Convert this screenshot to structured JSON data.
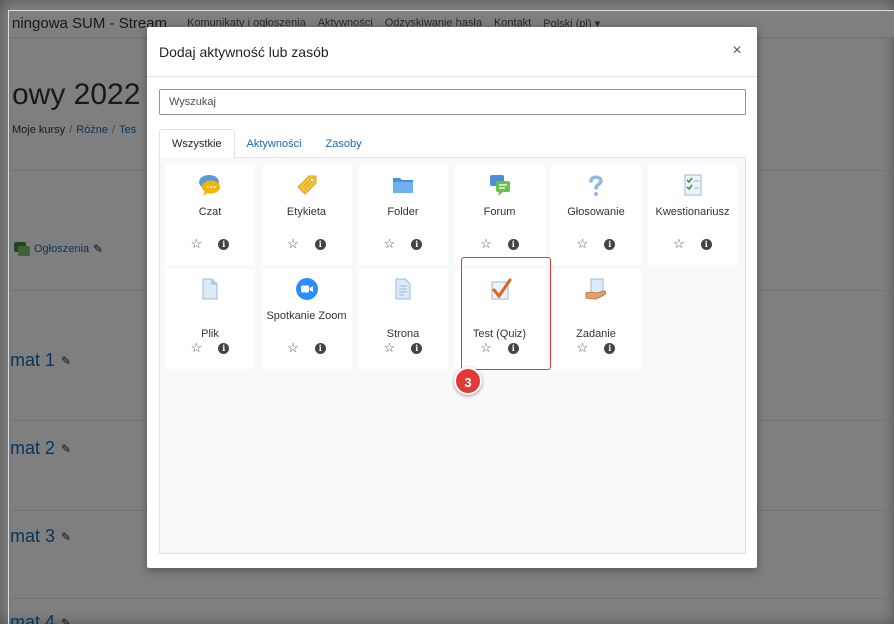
{
  "background": {
    "site_name": "ningowa SUM - Stream",
    "nav": [
      "Komunikaty i ogłoszenia",
      "Aktywności",
      "Odzyskiwanie hasła",
      "Kontakt",
      "Polski (pl) ▾"
    ],
    "course_title": "owy 2022",
    "breadcrumb": {
      "item1": "Moje kursy",
      "item2": "Różne",
      "item3": "Tes"
    },
    "announcements": "Ogłoszenia",
    "topics": [
      "mat 1",
      "mat 2",
      "mat 3",
      "mat 4"
    ]
  },
  "modal": {
    "title": "Dodaj aktywność lub zasób",
    "close": "×",
    "search_placeholder": "Wyszukaj",
    "tabs": [
      "Wszystkie",
      "Aktywności",
      "Zasoby"
    ],
    "items": [
      {
        "name": "Czat",
        "icon": "chat-icon"
      },
      {
        "name": "Etykieta",
        "icon": "label-icon"
      },
      {
        "name": "Folder",
        "icon": "folder-icon"
      },
      {
        "name": "Forum",
        "icon": "forum-icon"
      },
      {
        "name": "Głosowanie",
        "icon": "question-icon"
      },
      {
        "name": "Kwestionariusz",
        "icon": "questionnaire-icon"
      },
      {
        "name": "Plik",
        "icon": "file-icon"
      },
      {
        "name": "Spotkanie Zoom",
        "icon": "zoom-icon"
      },
      {
        "name": "Strona",
        "icon": "page-icon"
      },
      {
        "name": "Test (Quiz)",
        "icon": "quiz-icon"
      },
      {
        "name": "Zadanie",
        "icon": "assignment-icon"
      }
    ]
  },
  "annotation": {
    "step": "3",
    "color": "#e53935"
  },
  "colors": {
    "link": "#0f6cbf",
    "panel_bg": "#f8f9fa"
  }
}
